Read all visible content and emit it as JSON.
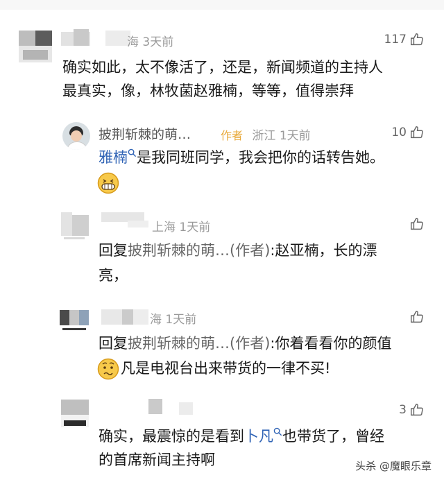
{
  "comments": [
    {
      "location_time": "海 3天前",
      "likes": "117",
      "line1": "确实如此，太不像活了，还是，新闻频道的主持人",
      "line2": "最真实，像，林牧菌赵雅楠，等等，值得崇拜"
    },
    {
      "username": "披荆斩棘的萌…",
      "author_tag": "作者",
      "location_time": "浙江 1天前",
      "likes": "10",
      "mention": "雅楠",
      "text": "是我同班同学，我会把你的话转告她。"
    },
    {
      "location_time": "上海 1天前",
      "reply_prefix": "回复",
      "reply_target": "披荆斩棘的萌…(作者)",
      "text_line1": ":赵亚楠，长的漂",
      "text_line2": "亮，"
    },
    {
      "location_time": "海 1天前",
      "reply_prefix": "回复",
      "reply_target": "披荆斩棘的萌…(作者)",
      "text_line1": ":你着看看你的颜值",
      "text_line2": "凡是电视台出来带货的一律不买!"
    },
    {
      "likes": "3",
      "text_before": "确实，最震惊的是看到",
      "mention": "卜凡",
      "text_after": "也带货了，曾经",
      "line2": "的首席新闻主持啊"
    }
  ],
  "watermark": "头杀 @魔眼乐章",
  "icons": {
    "like": "thumb-up-icon",
    "search": "search-link-icon",
    "grin": "grin-emoji-icon",
    "confused": "confused-emoji-icon"
  }
}
